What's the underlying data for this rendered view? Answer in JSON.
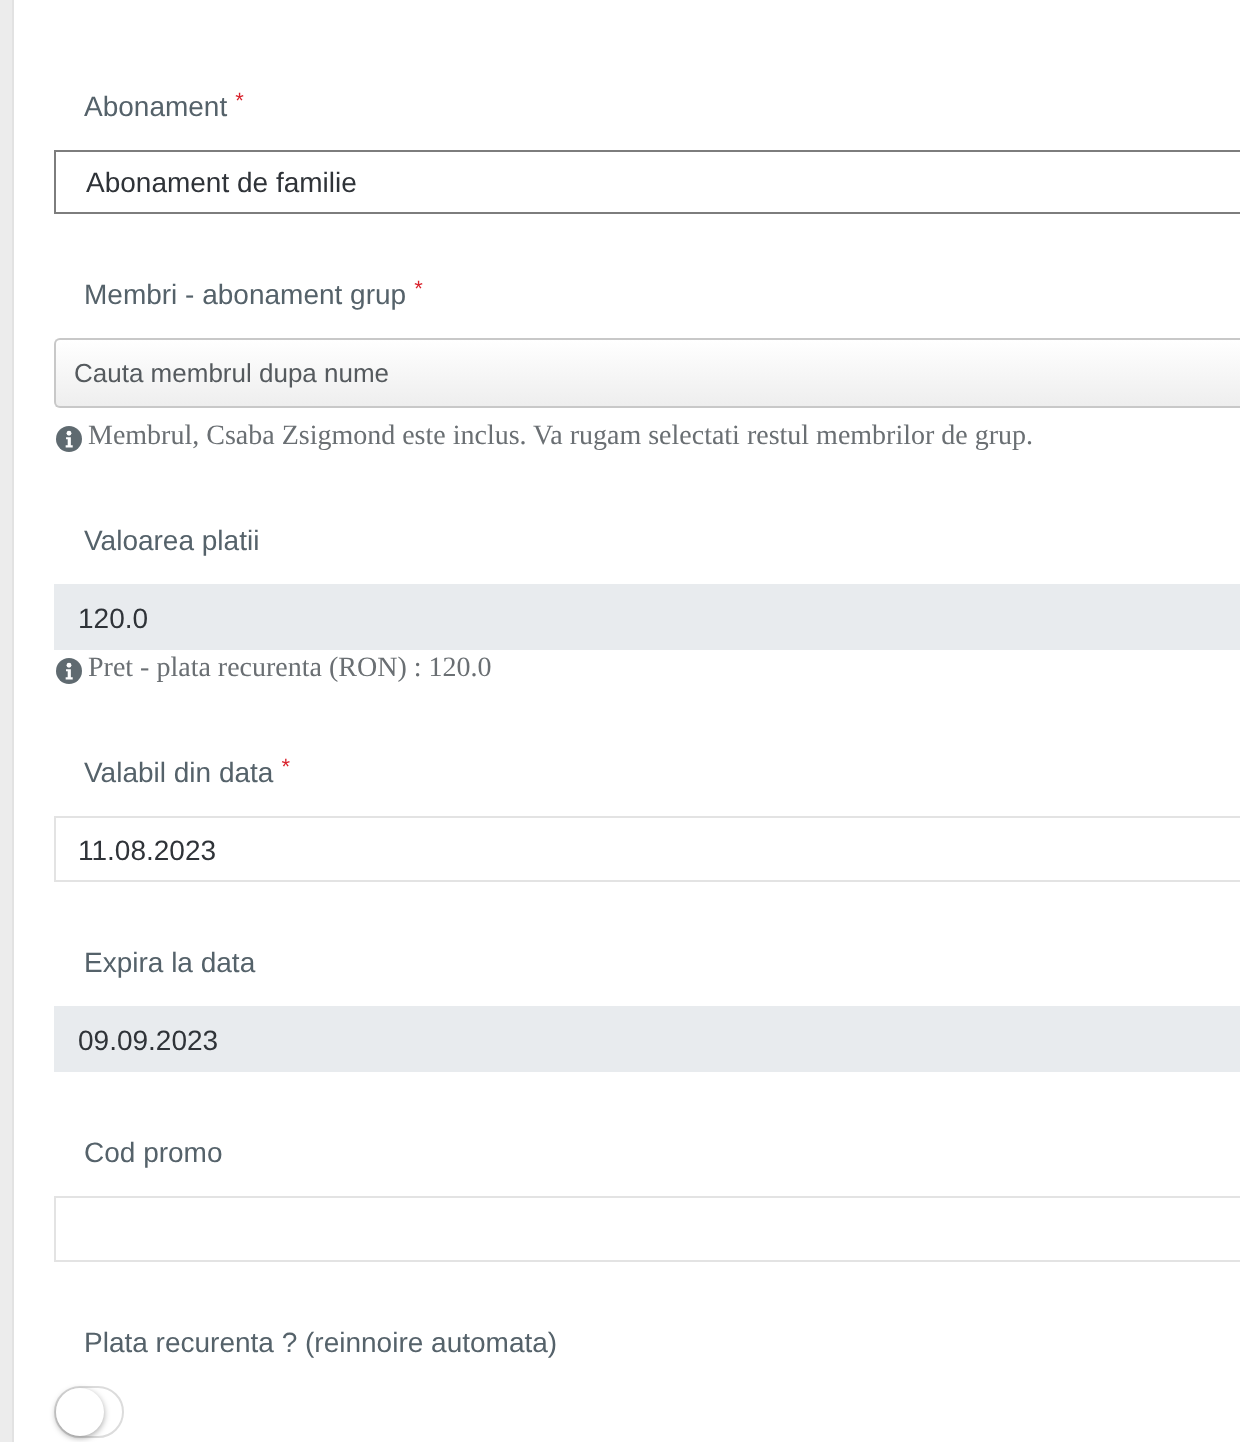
{
  "fields": [
    {
      "kind": "select",
      "label": "Abonament",
      "required_mark": "*",
      "value": "Abonament de familie"
    },
    {
      "kind": "search",
      "label": "Membri - abonament grup",
      "required_mark": "*",
      "placeholder": "Cauta membrul dupa nume",
      "help": "Membrul, Csaba Zsigmond este inclus. Va rugam selectati restul membrilor de grup."
    },
    {
      "kind": "text",
      "label": "Valoarea platii",
      "readonly": true,
      "value": "120.0",
      "help": "Pret - plata recurenta (RON) : 120.0"
    },
    {
      "kind": "text",
      "label": "Valabil din data",
      "required_mark": "*",
      "readonly": false,
      "value": "11.08.2023"
    },
    {
      "kind": "text",
      "label": "Expira la data",
      "readonly": true,
      "value": "09.09.2023"
    },
    {
      "kind": "text",
      "label": "Cod promo",
      "readonly": false
    },
    {
      "kind": "toggle",
      "label": "Plata recurenta ? (reinnoire automata)",
      "on": false
    }
  ]
}
